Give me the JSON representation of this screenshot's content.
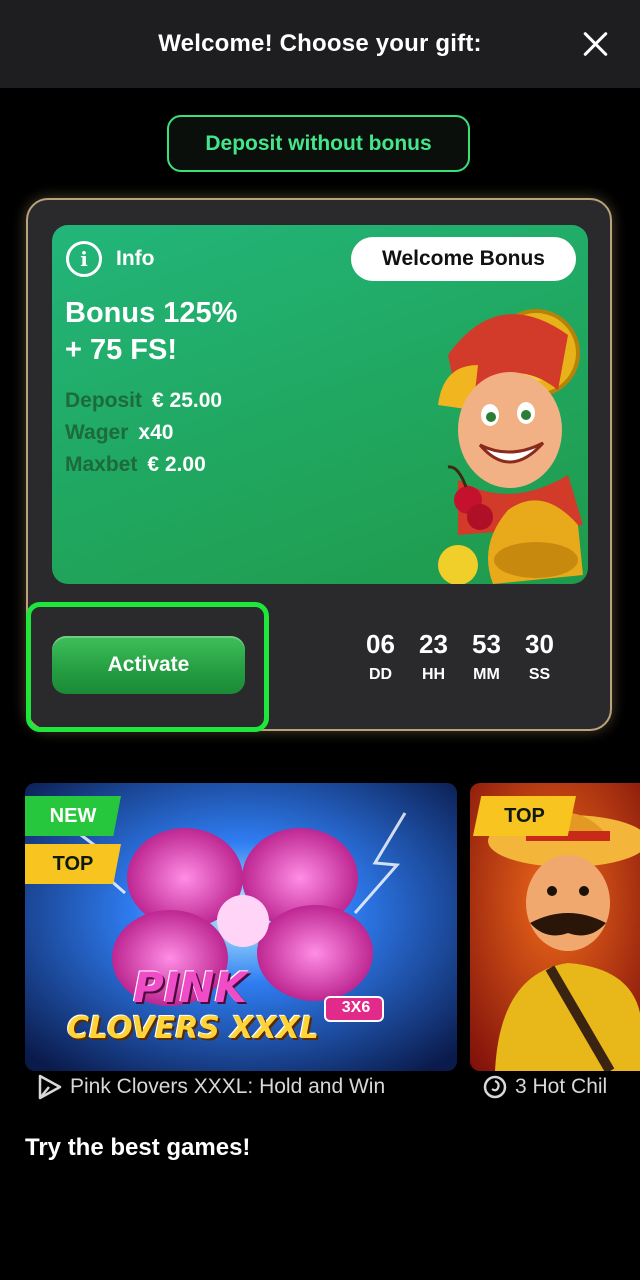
{
  "header": {
    "title": "Welcome! Choose your gift:",
    "close_icon": "close-icon"
  },
  "deposit_button": {
    "label": "Deposit without bonus"
  },
  "bonus": {
    "info_label": "Info",
    "info_icon": "info-icon",
    "badge": "Welcome Bonus",
    "title_line1": "Bonus 125%",
    "title_line2": "+ 75 FS!",
    "details": [
      {
        "key": "Deposit",
        "value": "€ 25.00"
      },
      {
        "key": "Wager",
        "value": "x40"
      },
      {
        "key": "Maxbet",
        "value": "€ 2.00"
      }
    ],
    "activate_label": "Activate",
    "timer": [
      {
        "value": "06",
        "unit": "DD"
      },
      {
        "value": "23",
        "unit": "HH"
      },
      {
        "value": "53",
        "unit": "MM"
      },
      {
        "value": "30",
        "unit": "SS"
      }
    ]
  },
  "games": [
    {
      "logo_line1": "PINK",
      "logo_line2": "CLOVERS XXXL",
      "logo_badge": "3X6",
      "tags": [
        "NEW",
        "TOP"
      ],
      "caption": "Pink Clovers XXXL: Hold and Win",
      "provider_icon": "play-triangle-icon"
    },
    {
      "tags": [
        "TOP"
      ],
      "caption": "3 Hot Chil",
      "provider_icon": "spiral-icon"
    }
  ],
  "section_title": "Try the best games!",
  "colors": {
    "accent_green": "#3ae07a",
    "card_green": "#20a861",
    "highlight_outline": "#1fe63b",
    "tag_yellow": "#f7c420"
  }
}
